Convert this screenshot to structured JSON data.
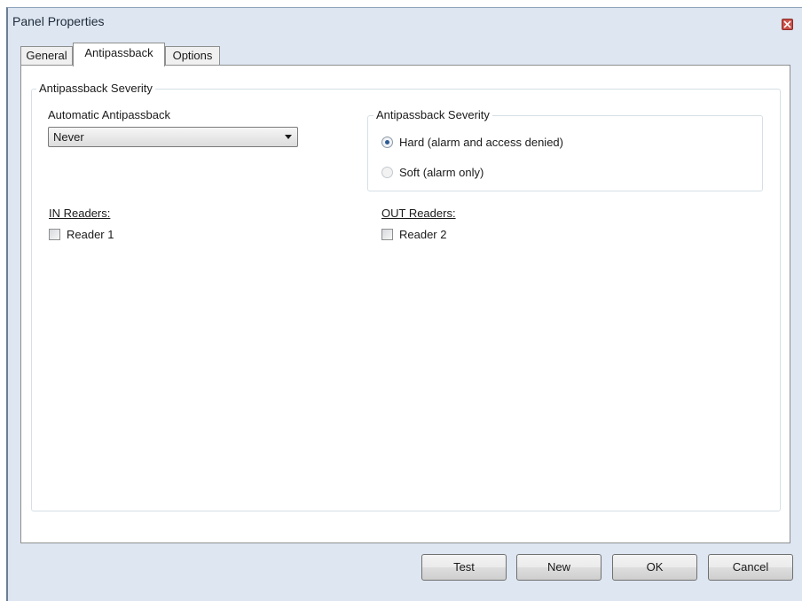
{
  "window": {
    "title": "Panel Properties"
  },
  "tabs": [
    {
      "label": "General"
    },
    {
      "label": "Antipassback"
    },
    {
      "label": "Options"
    }
  ],
  "outer_group": {
    "label": "Antipassback Severity"
  },
  "automatic": {
    "label": "Automatic Antipassback",
    "value": "Never"
  },
  "severity_group": {
    "label": "Antipassback Severity",
    "options": [
      {
        "label": "Hard (alarm and access denied)",
        "checked": true
      },
      {
        "label": "Soft (alarm only)",
        "checked": false
      }
    ]
  },
  "in_readers": {
    "label": "IN Readers:",
    "items": [
      {
        "label": "Reader 1",
        "checked": false
      }
    ]
  },
  "out_readers": {
    "label": "OUT Readers:",
    "items": [
      {
        "label": "Reader 2",
        "checked": false
      }
    ]
  },
  "buttons": {
    "test": "Test",
    "new": "New",
    "ok": "OK",
    "cancel": "Cancel"
  },
  "colors": {
    "window_bg": "#dde6f1",
    "panel_bg": "#ffffff",
    "radio_selected": "#2d5a96",
    "close_button": "#c9524a"
  },
  "icons": {
    "close": "close-icon",
    "dropdown": "chevron-down-icon"
  }
}
